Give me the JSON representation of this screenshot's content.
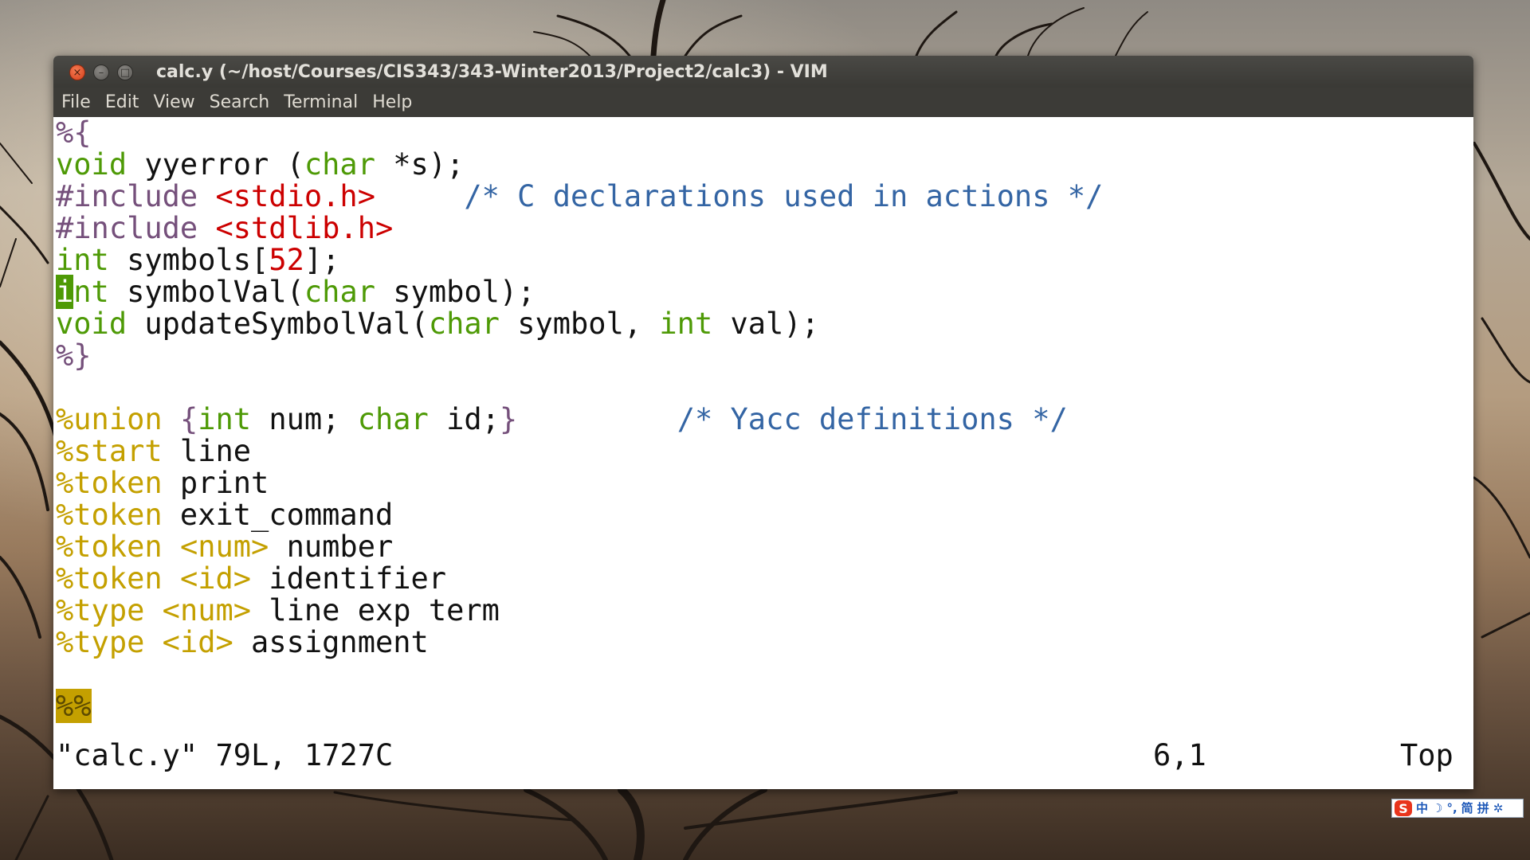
{
  "window": {
    "title": "calc.y (~/host/Courses/CIS343/343-Winter2013/Project2/calc3) - VIM",
    "controls": {
      "close": "×",
      "minimize": "–",
      "maximize": "□"
    }
  },
  "menu": {
    "file": "File",
    "edit": "Edit",
    "view": "View",
    "search": "Search",
    "terminal": "Terminal",
    "help": "Help"
  },
  "code": {
    "l1": "%{",
    "l2": {
      "kw": "void",
      "a": " yyerror (",
      "kw2": "char",
      "b": " *s);"
    },
    "l3": {
      "pre": "#include ",
      "str": "<stdio.h>",
      "gap": "     ",
      "cmt": "/* C declarations used in actions */"
    },
    "l4": {
      "pre": "#include ",
      "str": "<stdlib.h>"
    },
    "l5": {
      "kw": "int",
      "a": " symbols[",
      "num": "52",
      "b": "];"
    },
    "l6": {
      "cursor": "i",
      "kw": "nt",
      "a": " symbolVal(",
      "kw2": "char",
      "b": " symbol);"
    },
    "l7": {
      "kw": "void",
      "a": " updateSymbolVal(",
      "kw2": "char",
      "b": " symbol, ",
      "kw3": "int",
      "c": " val);"
    },
    "l8": "%}",
    "l9": {
      "yk": "%union",
      "sp": " ",
      "br1": "{",
      "kw": "int",
      "a": " num; ",
      "kw2": "char",
      "b": " id;",
      "br2": "}",
      "gap": "         ",
      "cmt": "/* Yacc definitions */"
    },
    "l10": {
      "yk": "%start",
      "a": " line"
    },
    "l11": {
      "yk": "%token",
      "a": " print"
    },
    "l12": {
      "yk": "%token",
      "a": " exit_command"
    },
    "l13": {
      "yk": "%token",
      "sp": " ",
      "tag": "<num>",
      "a": " number"
    },
    "l14": {
      "yk": "%token",
      "sp": " ",
      "tag": "<id>",
      "a": " identifier"
    },
    "l15": {
      "yk": "%type",
      "sp": " ",
      "tag": "<num>",
      "a": " line exp term"
    },
    "l16": {
      "yk": "%type",
      "sp": " ",
      "tag": "<id>",
      "a": " assignment"
    },
    "l18": "%%"
  },
  "status": {
    "file_info": "\"calc.y\" 79L, 1727C",
    "position": "6,1",
    "scroll": "Top"
  },
  "ime": {
    "logo": "S",
    "lang": "中",
    "moon": "☽",
    "punct": "°,",
    "simplified": "简",
    "pinyin": "拼",
    "settings": "✲"
  },
  "colors": {
    "keyword": "#4e9a06",
    "preproc": "#75507b",
    "string": "#cc0000",
    "comment": "#3465a4",
    "yacc": "#c4a000"
  }
}
